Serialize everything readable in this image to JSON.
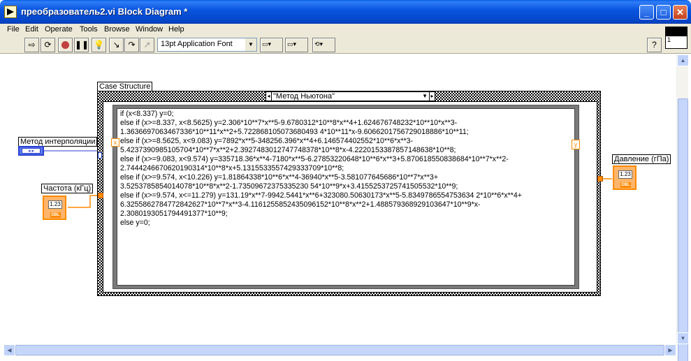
{
  "window": {
    "title": "преобразователь2.vi Block Diagram *",
    "minimize_glyph": "_",
    "maximize_glyph": "□",
    "close_glyph": "✕"
  },
  "menu": {
    "items": [
      "File",
      "Edit",
      "Operate",
      "Tools",
      "Browse",
      "Window",
      "Help"
    ]
  },
  "toolbar": {
    "font_select_value": "13pt Application Font",
    "icons": [
      "run-arrow-icon",
      "run-continuously-icon",
      "abort-icon",
      "pause-icon",
      "highlight-execution-icon",
      "step-into-icon",
      "step-over-icon",
      "step-out-icon",
      "align-objects-icon",
      "distribute-objects-icon",
      "reorder-icon",
      "help-icon"
    ],
    "help_glyph": "?",
    "vi_icon_number": "1"
  },
  "diagram": {
    "case_structure_label": "Case Structure",
    "case_selector_value": "\"Метод Ньютона\"",
    "formula_x": "x",
    "formula_y": "y",
    "formula_lines": [
      "if (x<8.337) y=0;",
      "else if (x>=8.337, x<8.5625) y=2.306*10**7*x**5-9.6780312*10**8*x**4+1.624676748232*10**10*x**3-",
      "1.3636697063467336*10**11*x**2+5.722868105073680493 4*10**11*x-9.6066201756729018886*10**11;",
      "else if (x>=8.5625, x<9.083) y=7892*x**5-348256.396*x**4+6.146574402552*10**6*x**3-",
      "5.4237390985105704*10**7*x**2+2.3927483012747748378*10**8*x-4.2220153387857148638*10**8;",
      "else if (x>=9.083, x<9.574) y=335718.36*x**4-7180*x**5-6.27853220648*10**6*x**3+5.870618550838684*10**7*x**2-",
      "2.7444246670620190314*10**8*x+5.1315533557429333709*10**8;",
      "else if (x>=9.574, x<10.226) y=1.81864338*10**6*x**4-36940*x**5-3.581077645686*10**7*x**3+",
      "3.5253785854014078*10**8*x**2-1.73509672375335230 54*10**9*x+3.4155253725741505532*10**9;",
      "else if (x>=9.574, x<=11.279) y=131.19*x**7-9942.5441*x**6+323080.50630173*x**5-5.8349786554753634 2*10**6*x**4+",
      "6.3255862784772842627*10**7*x**3-4.1161255852435096152*10**8*x**2+1.488579368929103647*10**9*x-",
      "2.3080193051794491377*10**9;",
      "else y=0;"
    ],
    "method_label": "Метод интерполяции",
    "frequency_label": "Частота (кГц)",
    "pressure_label": "Давление (гПа)",
    "numeric_display": "1.23",
    "dbl_tag": "DBL",
    "enum_display": "◂ ▸"
  },
  "colors": {
    "titlebar": "#0a56e0",
    "chrome": "#ece9d8",
    "dbl_wire": "#ff8a00",
    "enum_wire": "#2a3fd0"
  }
}
